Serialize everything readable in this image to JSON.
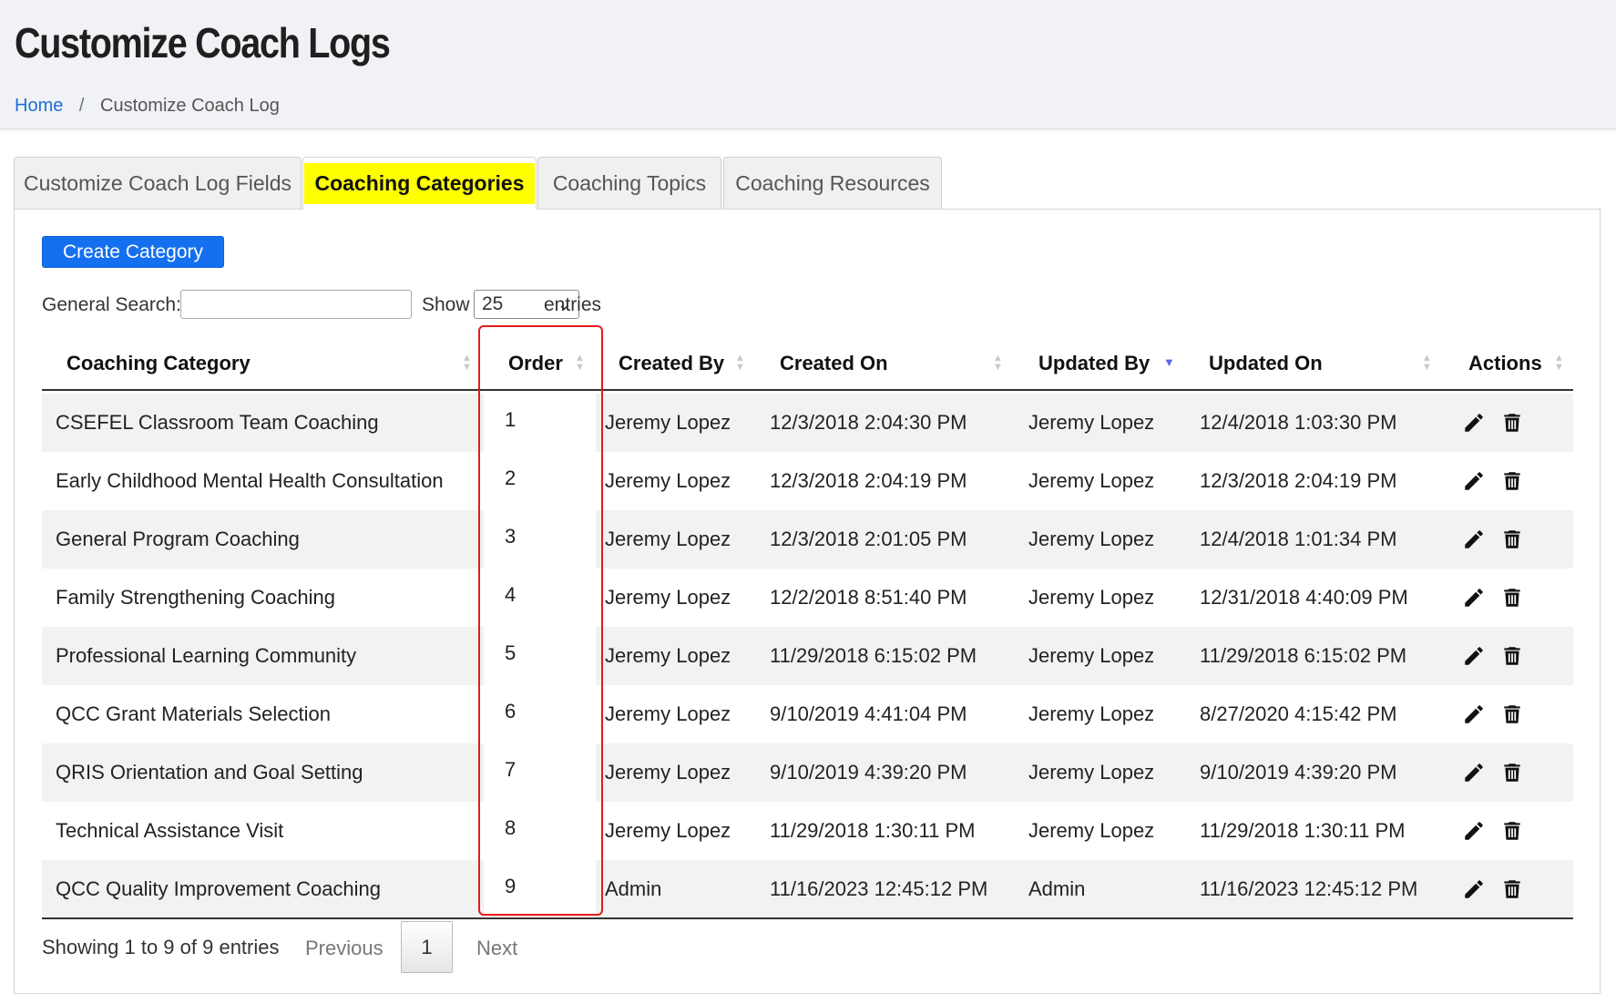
{
  "header": {
    "title": "Customize Coach Logs",
    "breadcrumb": {
      "home": "Home",
      "separator": "/",
      "current": "Customize Coach Log"
    }
  },
  "tabs": [
    {
      "label": "Customize Coach Log Fields",
      "active": false
    },
    {
      "label": "Coaching Categories",
      "active": true
    },
    {
      "label": "Coaching Topics",
      "active": false
    },
    {
      "label": "Coaching Resources",
      "active": false
    }
  ],
  "toolbar": {
    "create_label": "Create Category",
    "search_label": "General Search:",
    "search_value": "",
    "show_label": "Show",
    "page_size": "25",
    "entries_label": "entries"
  },
  "table": {
    "columns": [
      "Coaching Category",
      "Order",
      "Created By",
      "Created On",
      "Updated By",
      "Updated On",
      "Actions"
    ],
    "sorted_column": "Updated By",
    "sort_direction": "descending",
    "rows": [
      {
        "category": "CSEFEL Classroom Team Coaching",
        "order": "1",
        "created_by": "Jeremy Lopez",
        "created_on": "12/3/2018 2:04:30 PM",
        "updated_by": "Jeremy Lopez",
        "updated_on": "12/4/2018 1:03:30 PM"
      },
      {
        "category": "Early Childhood Mental Health Consultation",
        "order": "2",
        "created_by": "Jeremy Lopez",
        "created_on": "12/3/2018 2:04:19 PM",
        "updated_by": "Jeremy Lopez",
        "updated_on": "12/3/2018 2:04:19 PM"
      },
      {
        "category": "General Program Coaching",
        "order": "3",
        "created_by": "Jeremy Lopez",
        "created_on": "12/3/2018 2:01:05 PM",
        "updated_by": "Jeremy Lopez",
        "updated_on": "12/4/2018 1:01:34 PM"
      },
      {
        "category": "Family Strengthening Coaching",
        "order": "4",
        "created_by": "Jeremy Lopez",
        "created_on": "12/2/2018 8:51:40 PM",
        "updated_by": "Jeremy Lopez",
        "updated_on": "12/31/2018 4:40:09 PM"
      },
      {
        "category": "Professional Learning Community",
        "order": "5",
        "created_by": "Jeremy Lopez",
        "created_on": "11/29/2018 6:15:02 PM",
        "updated_by": "Jeremy Lopez",
        "updated_on": "11/29/2018 6:15:02 PM"
      },
      {
        "category": "QCC Grant Materials Selection",
        "order": "6",
        "created_by": "Jeremy Lopez",
        "created_on": "9/10/2019 4:41:04 PM",
        "updated_by": "Jeremy Lopez",
        "updated_on": "8/27/2020 4:15:42 PM"
      },
      {
        "category": "QRIS Orientation and Goal Setting",
        "order": "7",
        "created_by": "Jeremy Lopez",
        "created_on": "9/10/2019 4:39:20 PM",
        "updated_by": "Jeremy Lopez",
        "updated_on": "9/10/2019 4:39:20 PM"
      },
      {
        "category": "Technical Assistance Visit",
        "order": "8",
        "created_by": "Jeremy Lopez",
        "created_on": "11/29/2018 1:30:11 PM",
        "updated_by": "Jeremy Lopez",
        "updated_on": "11/29/2018 1:30:11 PM"
      },
      {
        "category": "QCC Quality Improvement Coaching",
        "order": "9",
        "created_by": "Admin",
        "created_on": "11/16/2023 12:45:12 PM",
        "updated_by": "Admin",
        "updated_on": "11/16/2023 12:45:12 PM"
      }
    ],
    "row_actions": [
      "pencil-icon",
      "trash-icon"
    ]
  },
  "footer": {
    "info": "Showing 1 to 9 of 9 entries",
    "previous": "Previous",
    "current_page": "1",
    "next": "Next"
  },
  "colors": {
    "primary": "#1570ef",
    "active_tab_highlight": "#ffff00",
    "annotation_box": "#e31b1b",
    "link": "#1d6fd8",
    "sort_active": "#5b6ee1"
  }
}
